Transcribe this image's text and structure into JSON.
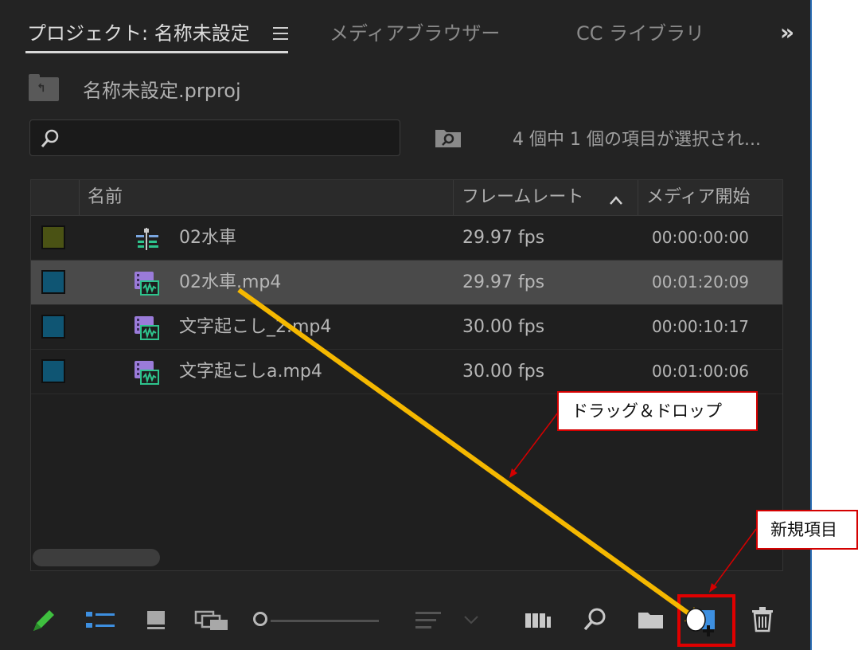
{
  "tabs": [
    {
      "label": "プロジェクト: 名称未設定",
      "active": true
    },
    {
      "label": "メディアブラウザー",
      "active": false
    },
    {
      "label": "CC ライブラリ",
      "active": false
    }
  ],
  "overflow_label": "»",
  "project": {
    "file_name": "名称未設定.prproj"
  },
  "search": {
    "value": "",
    "placeholder": ""
  },
  "selection_status": "4 個中 1 個の項目が選択され...",
  "table": {
    "columns": [
      "名前",
      "フレームレート",
      "メディア開始"
    ],
    "rows": [
      {
        "name": "02水車",
        "frame_rate": "29.97 fps",
        "media_start": "00:00:00:00",
        "label_color": "#4a5214",
        "icon": "sequence-icon",
        "selected": false
      },
      {
        "name": "02水車.mp4",
        "frame_rate": "29.97 fps",
        "media_start": "00:01:20:09",
        "label_color": "#0f5573",
        "icon": "video-clip-icon",
        "selected": true
      },
      {
        "name": "文字起こし_2.mp4",
        "frame_rate": "30.00 fps",
        "media_start": "00:00:10:17",
        "label_color": "#0f5573",
        "icon": "video-clip-icon",
        "selected": false
      },
      {
        "name": "文字起こしa.mp4",
        "frame_rate": "30.00 fps",
        "media_start": "00:01:00:06",
        "label_color": "#0f5573",
        "icon": "video-clip-icon",
        "selected": false
      }
    ]
  },
  "toolbar": {
    "items": [
      "pencil-icon",
      "list-view-icon",
      "icon-view-icon",
      "freeform-view-icon",
      "zoom-slider",
      "sort-icon",
      "automate-to-sequence-icon",
      "find-icon",
      "new-bin-icon",
      "new-item-icon",
      "trash-icon"
    ]
  },
  "annotations": {
    "drag_label": "ドラッグ＆ドロップ",
    "new_item_label": "新規項目"
  },
  "colors": {
    "accent": "#2d6fb5",
    "arrow": "#f5b800",
    "annotation": "#d40000",
    "video_icon": "#9a7bd9",
    "audio_icon": "#2ec48d"
  }
}
